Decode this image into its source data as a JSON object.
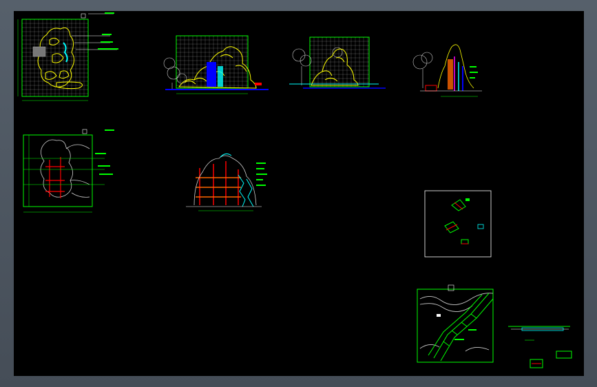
{
  "colors": {
    "background": "#000000",
    "frame": "#4c5560",
    "grid": "#ffffff",
    "border": "#00ff00",
    "rock": "#ffff00",
    "water": "#0000ff",
    "water_light": "#00ffff",
    "steel": "#ff0000",
    "structure": "#ff6600",
    "tree": "#d0d0d0",
    "label": "#ffffff",
    "accent": "#ff00ff"
  },
  "viewport": {
    "canvas": "model-space"
  }
}
